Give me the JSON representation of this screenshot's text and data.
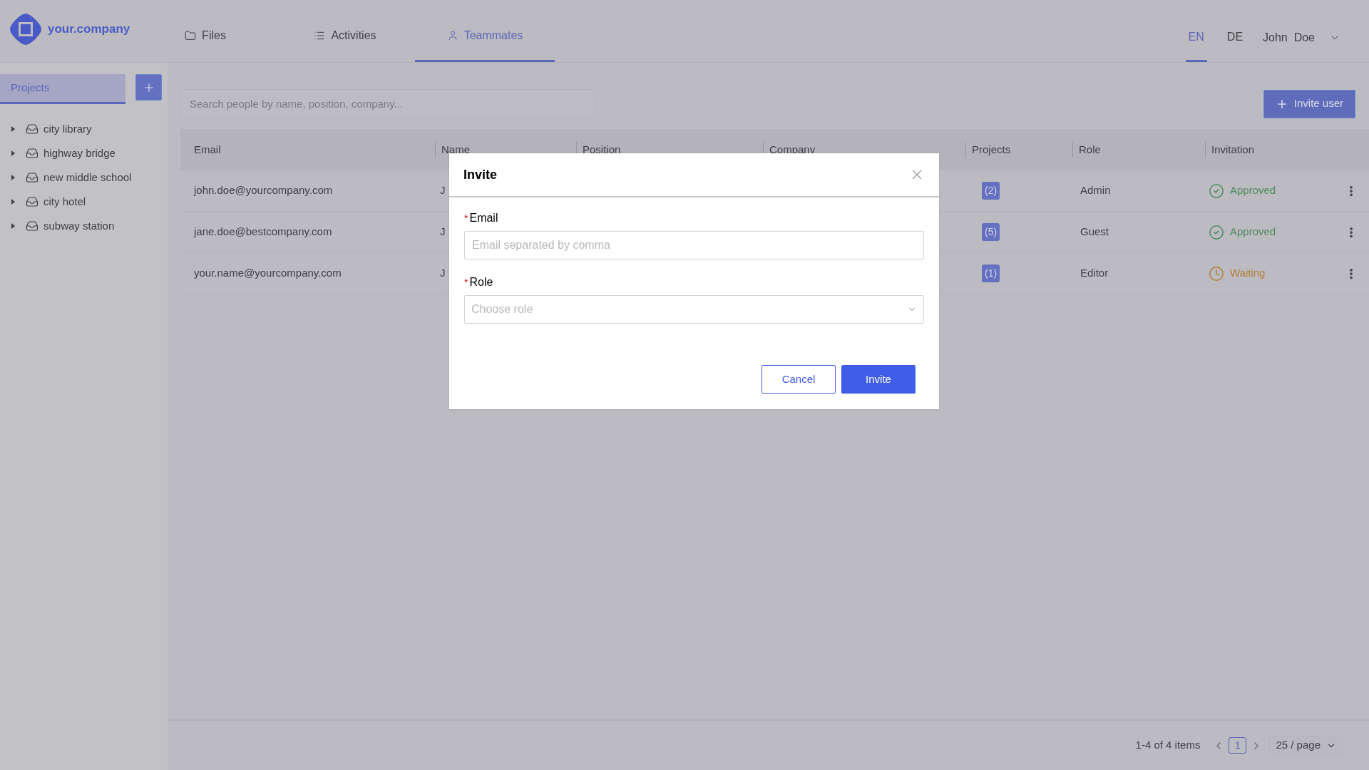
{
  "header": {
    "logo_text": "your.company",
    "nav_tabs": [
      {
        "label": "Files",
        "selected": false
      },
      {
        "label": "Activities",
        "selected": false
      },
      {
        "label": "Teammates",
        "selected": true
      }
    ],
    "languages": [
      {
        "label": "EN",
        "selected": true
      },
      {
        "label": "DE",
        "selected": false
      }
    ],
    "user_name": "John  Doe"
  },
  "sidebar": {
    "tab": {
      "label": "Projects",
      "selected": true
    },
    "projects": [
      {
        "label": "city library",
        "expanded": false
      },
      {
        "label": "highway bridge",
        "expanded": false
      },
      {
        "label": "new middle school",
        "expanded": false
      },
      {
        "label": "city hotel",
        "expanded": false
      },
      {
        "label": "subway station",
        "expanded": false
      }
    ]
  },
  "search": {
    "placeholder": "Search people by name, position, company..."
  },
  "invite_button": "Invite user",
  "table": {
    "columns": [
      "Email",
      "Name",
      "Position",
      "Company",
      "Projects",
      "Role",
      "Invitation"
    ],
    "rows": [
      {
        "email": "john.doe@yourcompany.com",
        "name": "J",
        "projects": "(2)",
        "role": "Admin",
        "invitation": {
          "label": "Approved",
          "kind": "approved"
        }
      },
      {
        "email": "jane.doe@bestcompany.com",
        "name": "J",
        "projects": "(5)",
        "role": "Guest",
        "invitation": {
          "label": "Approved",
          "kind": "approved"
        }
      },
      {
        "email": "your.name@yourcompany.com",
        "name": "J",
        "projects": "(1)",
        "role": "Editor",
        "invitation": {
          "label": "Waiting",
          "kind": "waiting"
        }
      }
    ]
  },
  "pagination": {
    "summary": "1-4 of 4 items",
    "pages": [
      {
        "label": "1",
        "selected": true
      }
    ],
    "page_size": "25 / page"
  },
  "dialog": {
    "title": "Invite",
    "fields": [
      {
        "label": "Email",
        "required_mark": "*",
        "kind": "input",
        "placeholder": "Email separated by comma"
      },
      {
        "label": "Role",
        "required_mark": "*",
        "kind": "select",
        "placeholder": "Choose role"
      }
    ],
    "buttons": [
      {
        "label": "Cancel",
        "kind": "secondary"
      },
      {
        "label": "Invite",
        "kind": "primary"
      }
    ]
  }
}
